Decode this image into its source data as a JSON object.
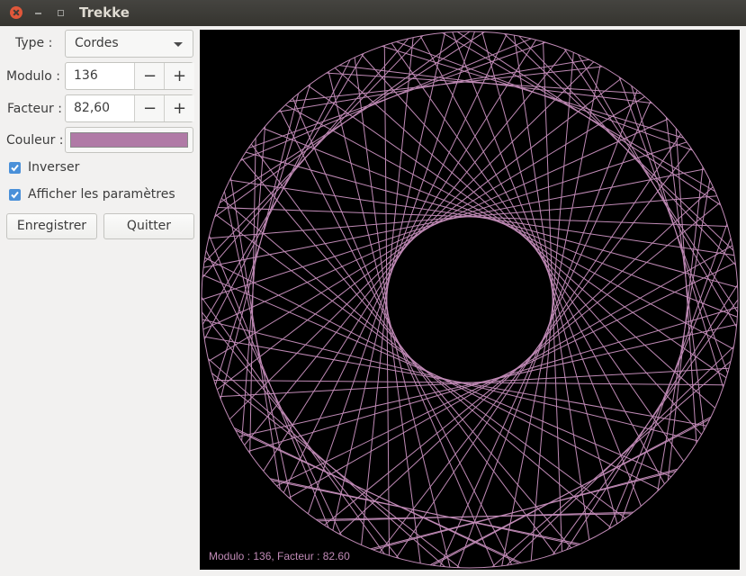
{
  "window": {
    "title": "Trekke"
  },
  "controls": {
    "type_label": "Type :",
    "type_value": "Cordes",
    "modulo_label": "Modulo :",
    "modulo_value": "136",
    "facteur_label": "Facteur :",
    "facteur_value": "82,60",
    "minus": "−",
    "plus": "+",
    "couleur_label": "Couleur :",
    "color": "#b07aa6",
    "inverser_label": "Inverser",
    "inverser_checked": true,
    "params_label": "Afficher les paramètres",
    "params_checked": true,
    "save_label": "Enregistrer",
    "quit_label": "Quitter"
  },
  "drawing": {
    "modulo": 136,
    "factor": 82.6,
    "line_color": "#c08ab6",
    "background": "#000000",
    "overlay_text": "Modulo : 136, Facteur : 82.60"
  }
}
